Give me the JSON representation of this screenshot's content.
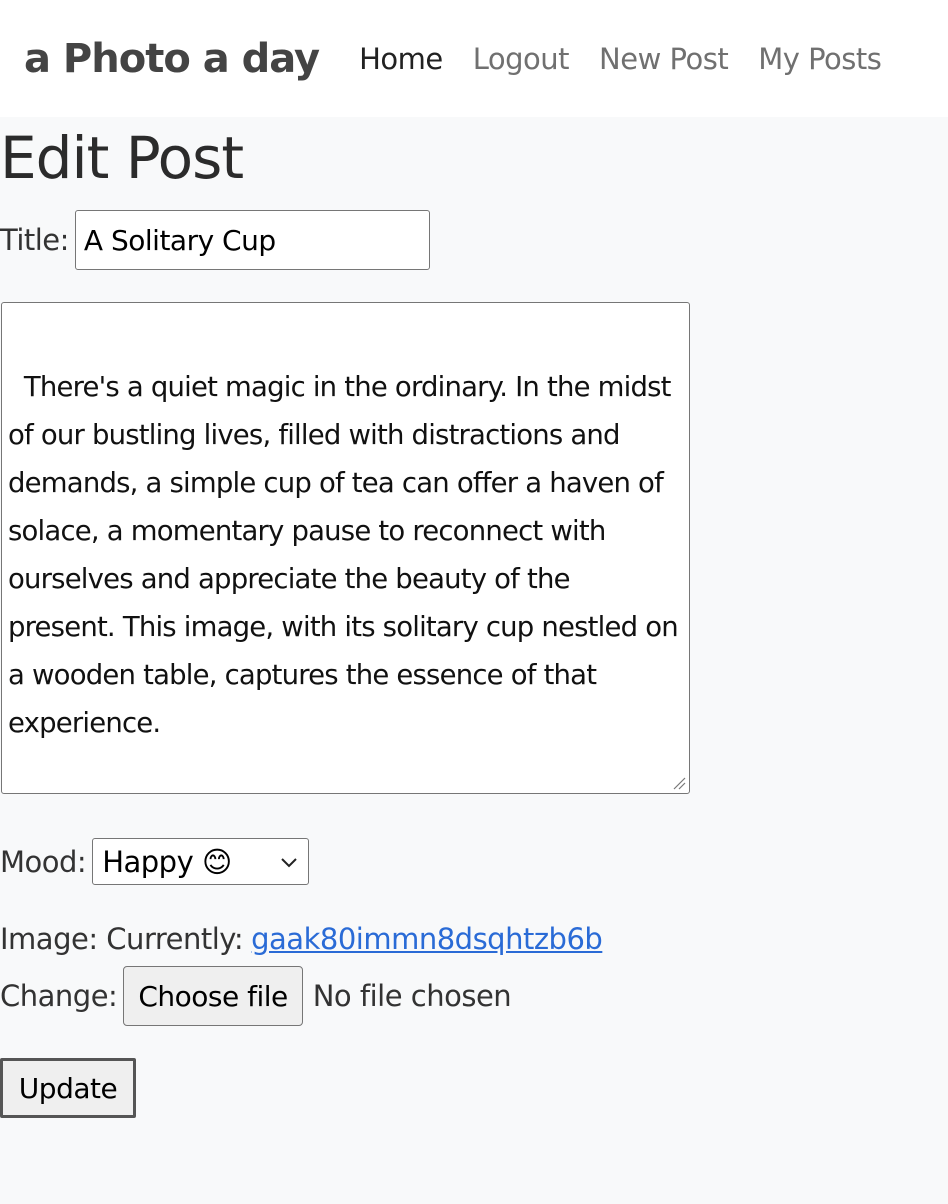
{
  "navbar": {
    "brand": "a Photo a day",
    "links": [
      {
        "label": "Home",
        "active": true
      },
      {
        "label": "Logout",
        "active": false
      },
      {
        "label": "New Post",
        "active": false
      },
      {
        "label": "My Posts",
        "active": false
      }
    ]
  },
  "page": {
    "title": "Edit Post"
  },
  "form": {
    "title_label": "Title:",
    "title_value": "A Solitary Cup",
    "body_value": "There's a quiet magic in the ordinary. In the midst of our bustling lives, filled with distractions and demands, a simple cup of tea can offer a haven of solace, a momentary pause to reconnect with ourselves and appreciate the beauty of the present. This image, with its solitary cup nestled on a wooden table, captures the essence of that experience.\n\n The white cup and saucer, devoid of any",
    "mood_label": "Mood:",
    "mood_selected": "Happy 😊",
    "image_label": "Image: Currently:",
    "image_current": "gaak80immn8dsqhtzb6b",
    "change_label": "Change:",
    "file_button_label": "Choose file",
    "file_status": "No file chosen",
    "submit_label": "Update"
  },
  "colors": {
    "link": "#2a6bd6",
    "page_background": "#f8f9fa"
  }
}
